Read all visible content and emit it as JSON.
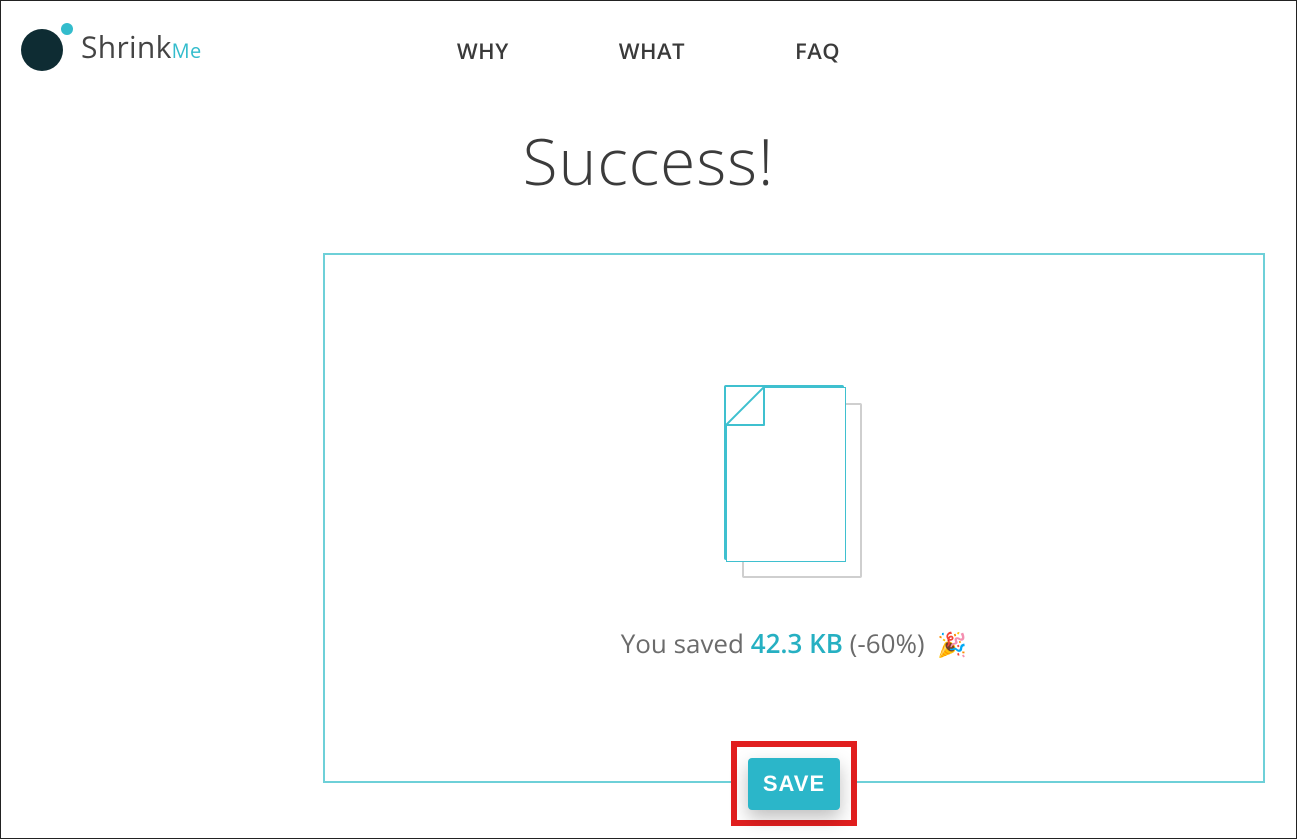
{
  "brand": {
    "name": "Shrink",
    "suffix": "Me"
  },
  "nav": {
    "why": "WHY",
    "what": "WHAT",
    "faq": "FAQ"
  },
  "page_title": "Success!",
  "result": {
    "prefix": "You saved ",
    "amount": "42.3 KB",
    "suffix": " (-60%) ",
    "emoji": "🎉"
  },
  "save_button_label": "SAVE",
  "colors": {
    "accent": "#2bb6c9",
    "panel_border": "#6ed0d8",
    "highlight_box": "#e11f1f",
    "logo_dark": "#0e2c33"
  }
}
